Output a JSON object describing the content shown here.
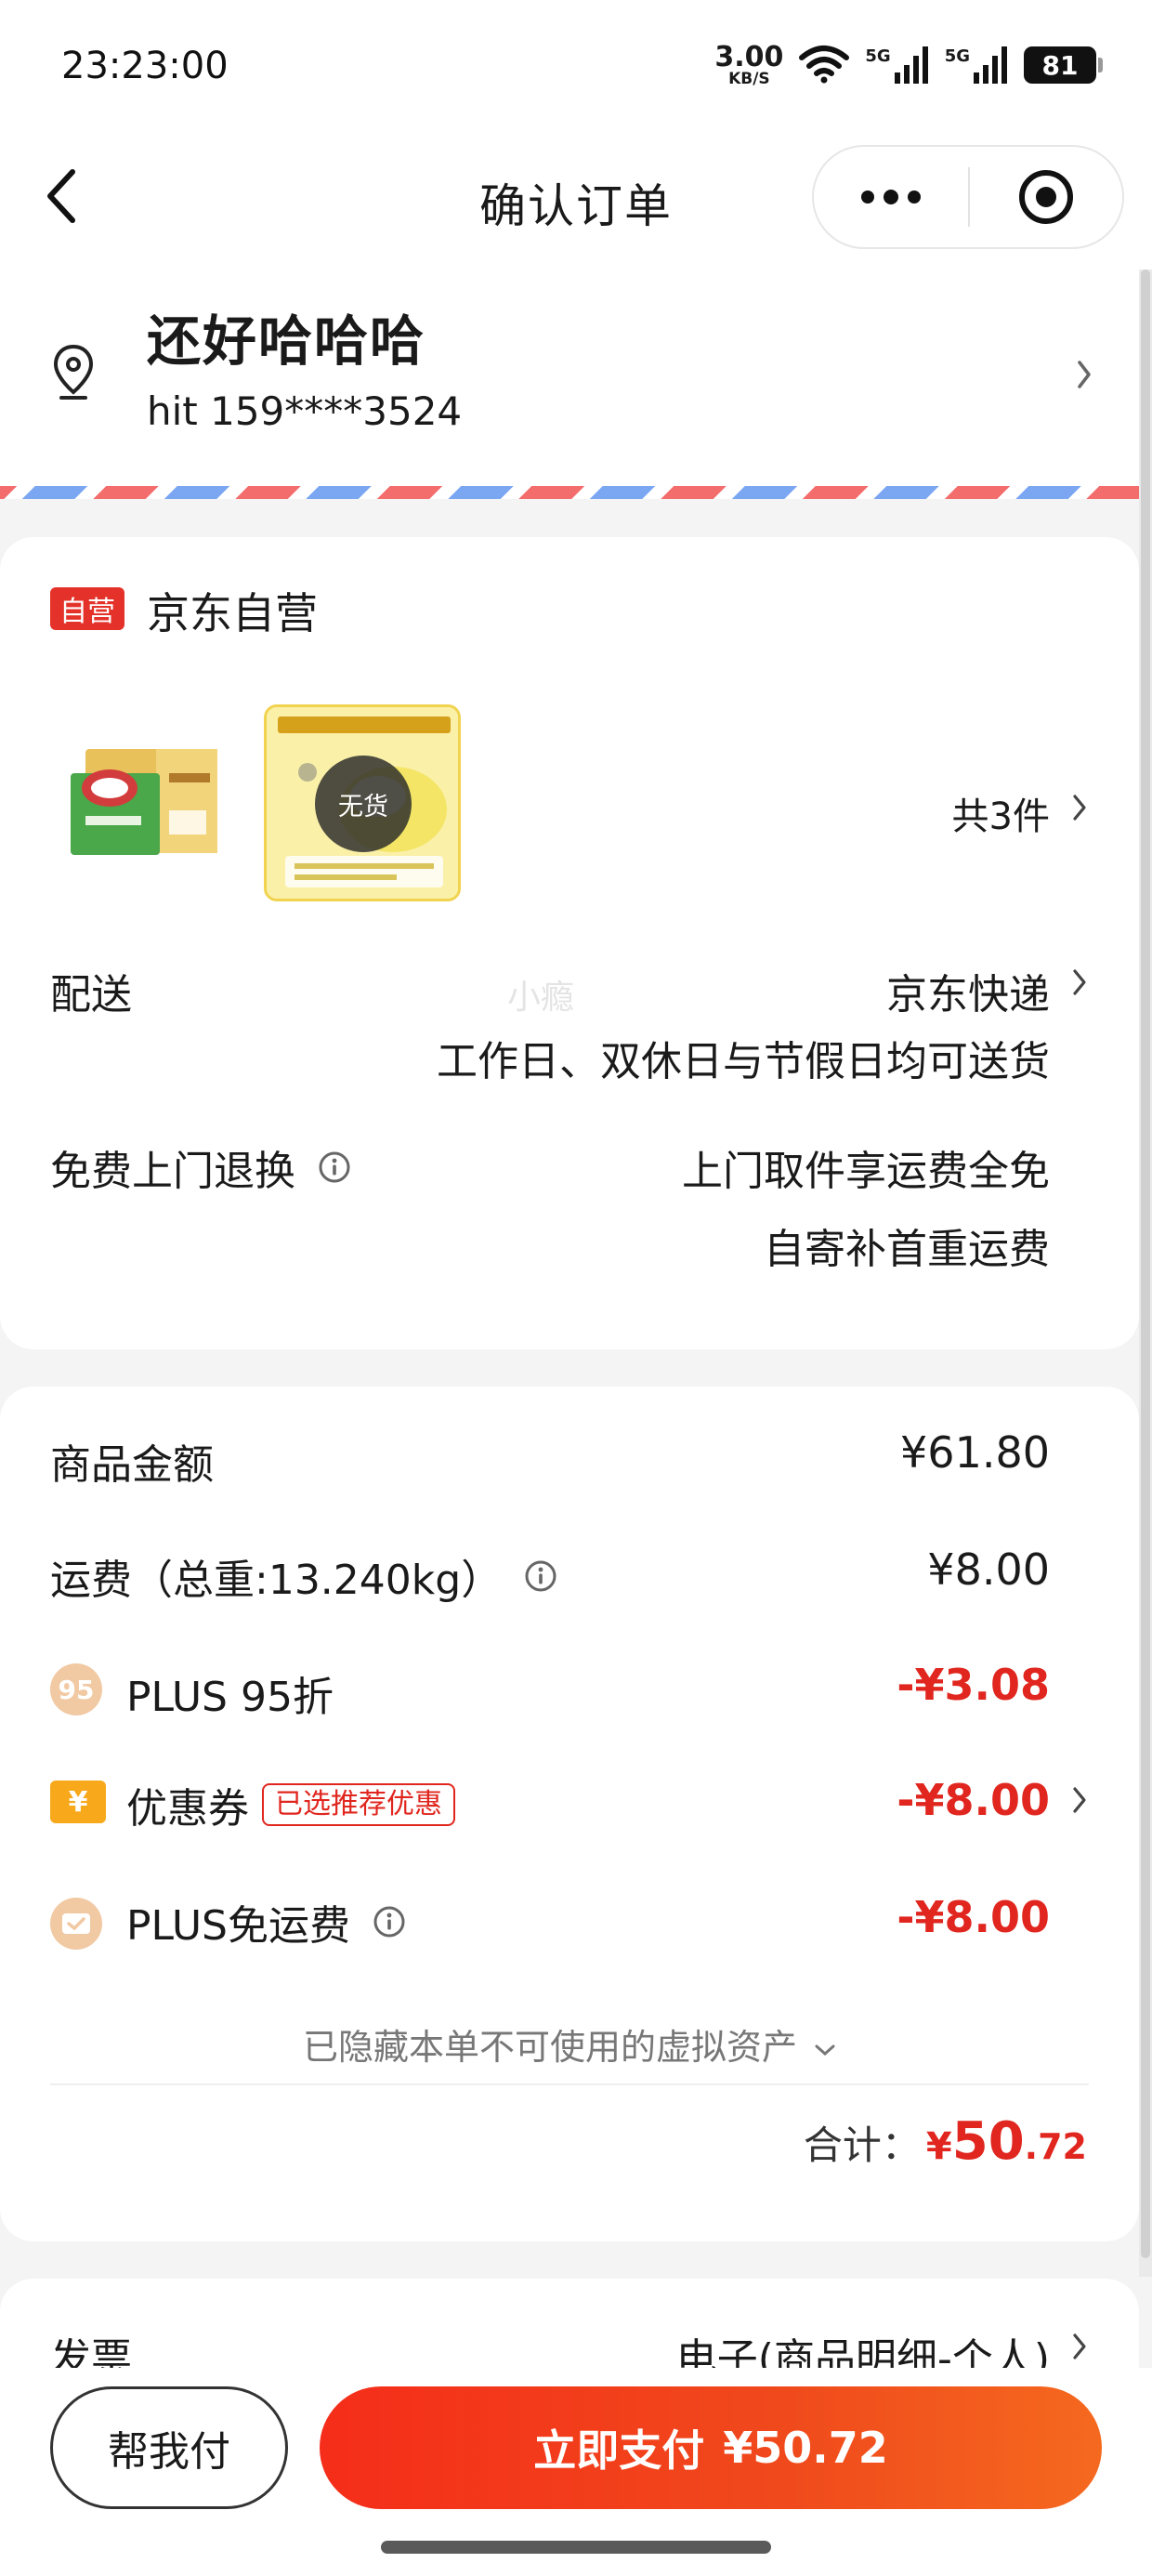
{
  "status_bar": {
    "time": "23:23:00",
    "net_speed": "3.00",
    "net_unit": "KB/S",
    "signal1": "5G",
    "signal2": "5G",
    "battery": "81"
  },
  "nav": {
    "title": "确认订单"
  },
  "address": {
    "name": "还好哈哈哈",
    "phone": "hit 159****3524"
  },
  "shop": {
    "badge": "自营",
    "name": "京东自营",
    "out_of_stock": "无货",
    "count": "共3件",
    "delivery_label": "配送",
    "delivery_value": "京东快递",
    "delivery_note": "工作日、双休日与节假日均可送货",
    "return_label": "免费上门退换",
    "return_line1": "上门取件享运费全免",
    "return_line2": "自寄补首重运费",
    "watermark": "小瘾"
  },
  "summary": {
    "goods_label": "商品金额",
    "goods_value": "¥61.80",
    "freight_label": "运费（总重:13.240kg）",
    "freight_value": "¥8.00",
    "plus_icon": "95",
    "plus_label": "PLUS 95折",
    "plus_value": "-¥3.08",
    "coupon_label": "优惠券",
    "coupon_tag": "已选推荐优惠",
    "coupon_value": "-¥8.00",
    "free_ship_label": "PLUS免运费",
    "free_ship_value": "-¥8.00",
    "hidden_assets": "已隐藏本单不可使用的虚拟资产",
    "total_label": "合计：",
    "total_yen": "¥",
    "total_int": "50",
    "total_dec": ".72"
  },
  "invoice": {
    "label": "发票",
    "value": "电子(商品明细-个人)"
  },
  "bottom": {
    "help_pay": "帮我付",
    "pay_label": "立即支付",
    "pay_amount": "¥50.72"
  },
  "colors": {
    "accent": "#e0261e",
    "pay_button": "#f23a1c",
    "badge": "#e4312a"
  }
}
